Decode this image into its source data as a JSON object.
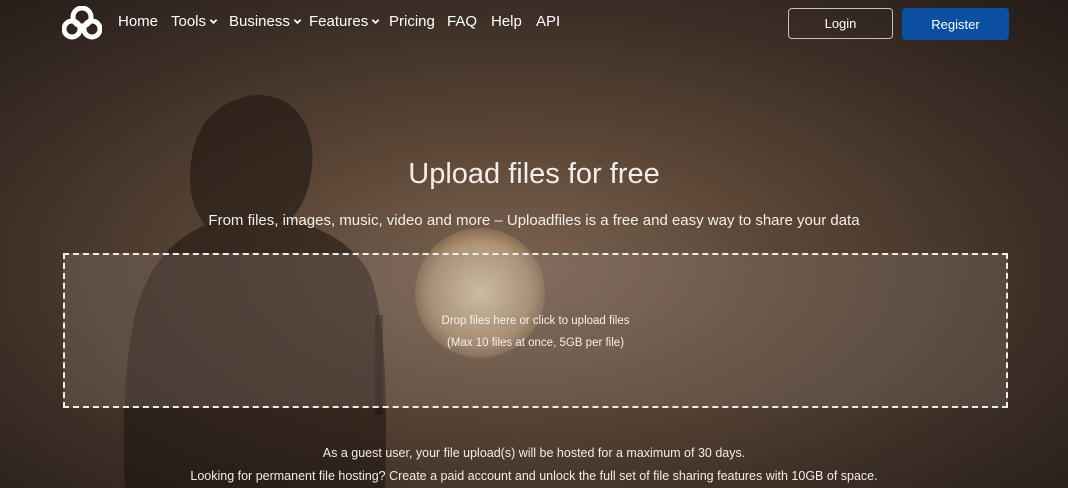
{
  "nav": {
    "logo_icon": "cloud-link-logo-icon",
    "items": [
      {
        "label": "Home",
        "dropdown": false
      },
      {
        "label": "Tools",
        "dropdown": true
      },
      {
        "label": "Business",
        "dropdown": true
      },
      {
        "label": "Features",
        "dropdown": true
      },
      {
        "label": "Pricing",
        "dropdown": false
      },
      {
        "label": "FAQ",
        "dropdown": false
      },
      {
        "label": "Help",
        "dropdown": false
      },
      {
        "label": "API",
        "dropdown": false
      }
    ],
    "login_label": "Login",
    "register_label": "Register"
  },
  "hero": {
    "title": "Upload files for free",
    "subtitle": "From files, images, music, video and more – Uploadfiles is a free and easy way to share your data"
  },
  "dropzone": {
    "main_text": "Drop files here or click to upload files",
    "limit_text": "(Max 10 files at once, 5GB per file)"
  },
  "notes": {
    "guest": "As a guest user, your file upload(s) will be hosted for a maximum of 30 days.",
    "permanent": "Looking for permanent file hosting? Create a paid account and unlock the full set of file sharing features with 10GB of space."
  },
  "colors": {
    "accent": "#0a4fa0",
    "background": "#4a3a2e"
  }
}
